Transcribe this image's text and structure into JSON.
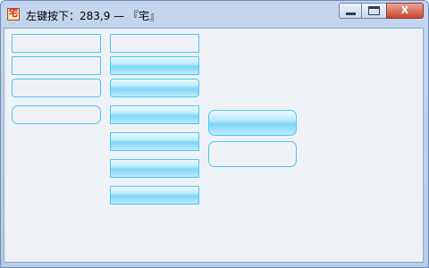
{
  "window": {
    "title": "左键按下：283,9 — 『宅』",
    "app_icon_glyph": "宅",
    "controls": {
      "minimize": "minimize-icon",
      "maximize": "maximize-icon",
      "close_label": "X"
    }
  },
  "colors": {
    "accent_border": "#4fc6ee",
    "client_background": "#eef2f7",
    "gradient_mid": "#7fd6f8"
  }
}
